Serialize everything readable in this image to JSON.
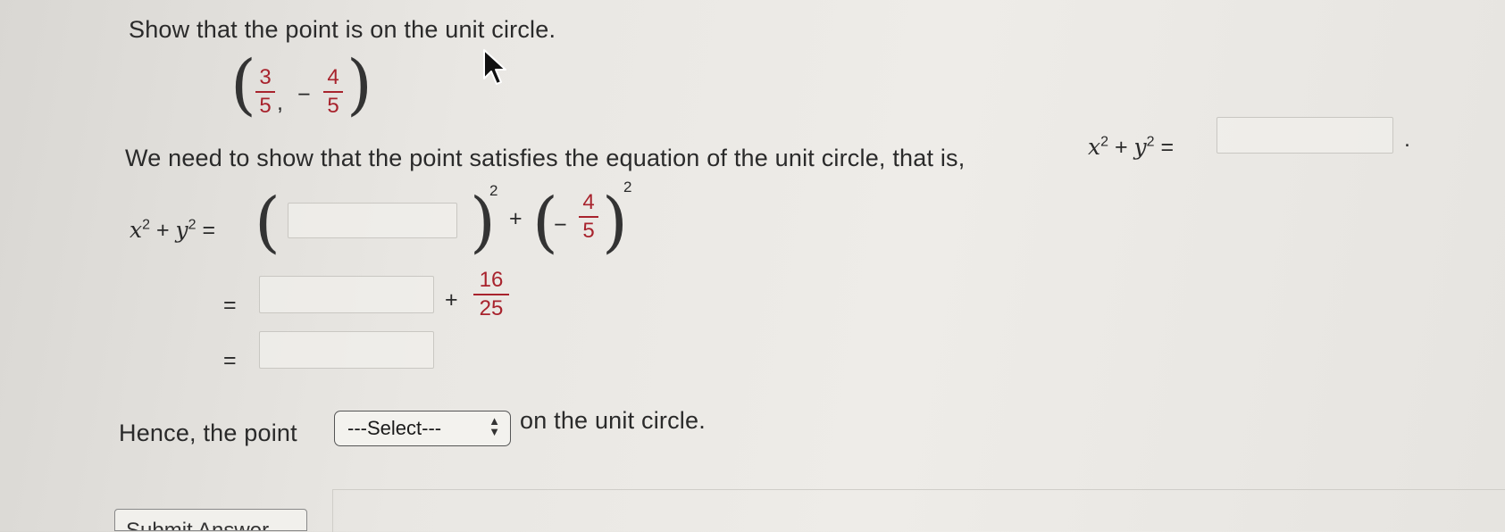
{
  "question": {
    "title": "Show that the point is on the unit circle.",
    "point": {
      "x_num": "3",
      "x_den": "5",
      "comma": ",",
      "y_sign": "−",
      "y_num": "4",
      "y_den": "5"
    }
  },
  "step1": {
    "text": "We need to show that the point satisfies the equation of the unit circle, that is,",
    "equation": "x² + y² =",
    "period": "."
  },
  "work": {
    "lhs": "x² + y² =",
    "exponent": "2",
    "plus": "+",
    "neg_sign": "−",
    "neg_num": "4",
    "neg_den": "5",
    "eq2": "=",
    "frac2_num": "16",
    "frac2_den": "25",
    "eq3": "="
  },
  "conclusion": {
    "before": "Hence, the point",
    "select_value": "---Select---",
    "after": "on the unit circle."
  },
  "submit_label": "Submit Answer"
}
